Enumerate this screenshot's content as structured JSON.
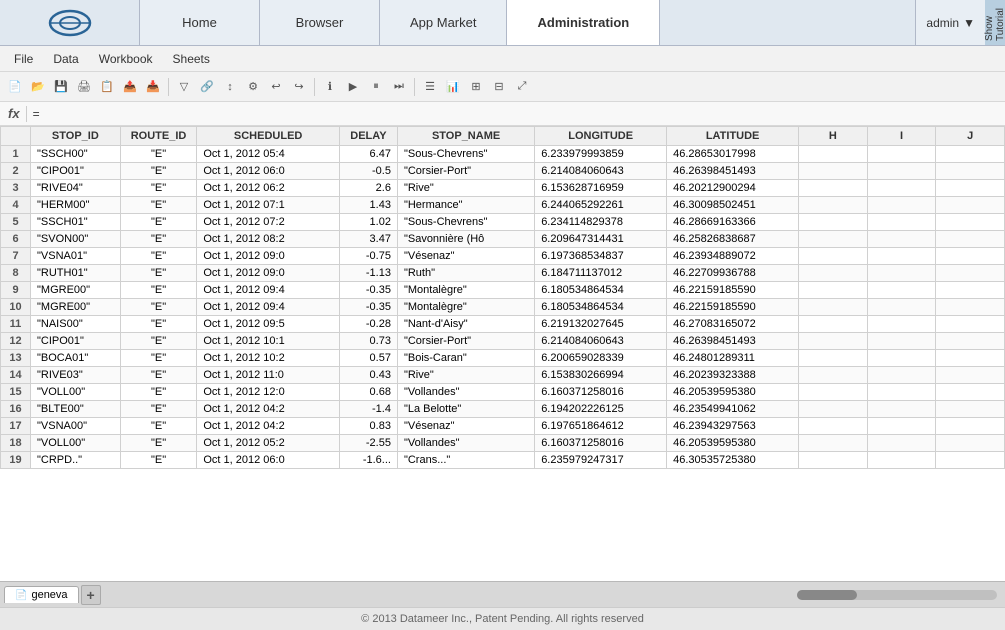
{
  "nav": {
    "tabs": [
      {
        "label": "Home",
        "active": false
      },
      {
        "label": "Browser",
        "active": false
      },
      {
        "label": "App Market",
        "active": false
      },
      {
        "label": "Administration",
        "active": true
      }
    ],
    "user": "admin",
    "tutorial_label": "Show Tutorial"
  },
  "menu": {
    "items": [
      "File",
      "Data",
      "Workbook",
      "Sheets"
    ]
  },
  "formula_bar": {
    "label": "fx",
    "value": "="
  },
  "columns": {
    "headers": [
      "STOP_ID",
      "ROUTE_ID",
      "SCHEDULED",
      "DELAY",
      "STOP_NAME",
      "LONGITUDE",
      "LATITUDE",
      "H",
      "I",
      "J"
    ]
  },
  "rows": [
    {
      "num": 1,
      "stop_id": "\"SSCH00\"",
      "route_id": "\"E\"",
      "scheduled": "Oct 1, 2012 05:4",
      "delay": "6.47",
      "stop_name": "\"Sous-Chevrens\"",
      "longitude": "6.233979993859",
      "latitude": "46.28653017998"
    },
    {
      "num": 2,
      "stop_id": "\"CIPO01\"",
      "route_id": "\"E\"",
      "scheduled": "Oct 1, 2012 06:0",
      "delay": "-0.5",
      "stop_name": "\"Corsier-Port\"",
      "longitude": "6.214084060643",
      "latitude": "46.26398451493"
    },
    {
      "num": 3,
      "stop_id": "\"RIVE04\"",
      "route_id": "\"E\"",
      "scheduled": "Oct 1, 2012 06:2",
      "delay": "2.6",
      "stop_name": "\"Rive\"",
      "longitude": "6.153628716959",
      "latitude": "46.20212900294"
    },
    {
      "num": 4,
      "stop_id": "\"HERM00\"",
      "route_id": "\"E\"",
      "scheduled": "Oct 1, 2012 07:1",
      "delay": "1.43",
      "stop_name": "\"Hermance\"",
      "longitude": "6.244065292261",
      "latitude": "46.30098502451"
    },
    {
      "num": 5,
      "stop_id": "\"SSCH01\"",
      "route_id": "\"E\"",
      "scheduled": "Oct 1, 2012 07:2",
      "delay": "1.02",
      "stop_name": "\"Sous-Chevrens\"",
      "longitude": "6.234114829378",
      "latitude": "46.28669163366"
    },
    {
      "num": 6,
      "stop_id": "\"SVON00\"",
      "route_id": "\"E\"",
      "scheduled": "Oct 1, 2012 08:2",
      "delay": "3.47",
      "stop_name": "\"Savonnière (Hô",
      "longitude": "6.209647314431",
      "latitude": "46.25826838687"
    },
    {
      "num": 7,
      "stop_id": "\"VSNA01\"",
      "route_id": "\"E\"",
      "scheduled": "Oct 1, 2012 09:0",
      "delay": "-0.75",
      "stop_name": "\"Vésenaz\"",
      "longitude": "6.197368534837",
      "latitude": "46.23934889072"
    },
    {
      "num": 8,
      "stop_id": "\"RUTH01\"",
      "route_id": "\"E\"",
      "scheduled": "Oct 1, 2012 09:0",
      "delay": "-1.13",
      "stop_name": "\"Ruth\"",
      "longitude": "6.184711137012",
      "latitude": "46.22709936788"
    },
    {
      "num": 9,
      "stop_id": "\"MGRE00\"",
      "route_id": "\"E\"",
      "scheduled": "Oct 1, 2012 09:4",
      "delay": "-0.35",
      "stop_name": "\"Montalègre\"",
      "longitude": "6.180534864534",
      "latitude": "46.22159185590"
    },
    {
      "num": 10,
      "stop_id": "\"MGRE00\"",
      "route_id": "\"E\"",
      "scheduled": "Oct 1, 2012 09:4",
      "delay": "-0.35",
      "stop_name": "\"Montalègre\"",
      "longitude": "6.180534864534",
      "latitude": "46.22159185590"
    },
    {
      "num": 11,
      "stop_id": "\"NAIS00\"",
      "route_id": "\"E\"",
      "scheduled": "Oct 1, 2012 09:5",
      "delay": "-0.28",
      "stop_name": "\"Nant-d'Aisy\"",
      "longitude": "6.219132027645",
      "latitude": "46.27083165072"
    },
    {
      "num": 12,
      "stop_id": "\"CIPO01\"",
      "route_id": "\"E\"",
      "scheduled": "Oct 1, 2012 10:1",
      "delay": "0.73",
      "stop_name": "\"Corsier-Port\"",
      "longitude": "6.214084060643",
      "latitude": "46.26398451493"
    },
    {
      "num": 13,
      "stop_id": "\"BOCA01\"",
      "route_id": "\"E\"",
      "scheduled": "Oct 1, 2012 10:2",
      "delay": "0.57",
      "stop_name": "\"Bois-Caran\"",
      "longitude": "6.200659028339",
      "latitude": "46.24801289311"
    },
    {
      "num": 14,
      "stop_id": "\"RIVE03\"",
      "route_id": "\"E\"",
      "scheduled": "Oct 1, 2012 11:0",
      "delay": "0.43",
      "stop_name": "\"Rive\"",
      "longitude": "6.153830266994",
      "latitude": "46.20239323388"
    },
    {
      "num": 15,
      "stop_id": "\"VOLL00\"",
      "route_id": "\"E\"",
      "scheduled": "Oct 1, 2012 12:0",
      "delay": "0.68",
      "stop_name": "\"Vollandes\"",
      "longitude": "6.160371258016",
      "latitude": "46.20539595380"
    },
    {
      "num": 16,
      "stop_id": "\"BLTE00\"",
      "route_id": "\"E\"",
      "scheduled": "Oct 1, 2012 04:2",
      "delay": "-1.4",
      "stop_name": "\"La Belotte\"",
      "longitude": "6.194202226125",
      "latitude": "46.23549941062"
    },
    {
      "num": 17,
      "stop_id": "\"VSNA00\"",
      "route_id": "\"E\"",
      "scheduled": "Oct 1, 2012 04:2",
      "delay": "0.83",
      "stop_name": "\"Vésenaz\"",
      "longitude": "6.197651864612",
      "latitude": "46.23943297563"
    },
    {
      "num": 18,
      "stop_id": "\"VOLL00\"",
      "route_id": "\"E\"",
      "scheduled": "Oct 1, 2012 05:2",
      "delay": "-2.55",
      "stop_name": "\"Vollandes\"",
      "longitude": "6.160371258016",
      "latitude": "46.20539595380"
    },
    {
      "num": 19,
      "stop_id": "\"CRPD..\"",
      "route_id": "\"E\"",
      "scheduled": "Oct 1, 2012 06:0",
      "delay": "-1.6...",
      "stop_name": "\"Crans...\"",
      "longitude": "6.235979247317",
      "latitude": "46.30535725380"
    }
  ],
  "sheet_tabs": [
    {
      "label": "geneva",
      "active": true
    }
  ],
  "footer": {
    "text": "© 2013 Datameer Inc., Patent Pending. All rights reserved"
  },
  "toolbar": {
    "buttons": [
      "📄",
      "💾",
      "📋",
      "📋",
      "🔄",
      "📤",
      "▶",
      "⚙",
      "🔍",
      "🔗",
      "↩",
      "↪",
      "▶",
      "⏸",
      "❓",
      "📊",
      "📋",
      "🔢",
      "📑",
      "📈"
    ]
  }
}
